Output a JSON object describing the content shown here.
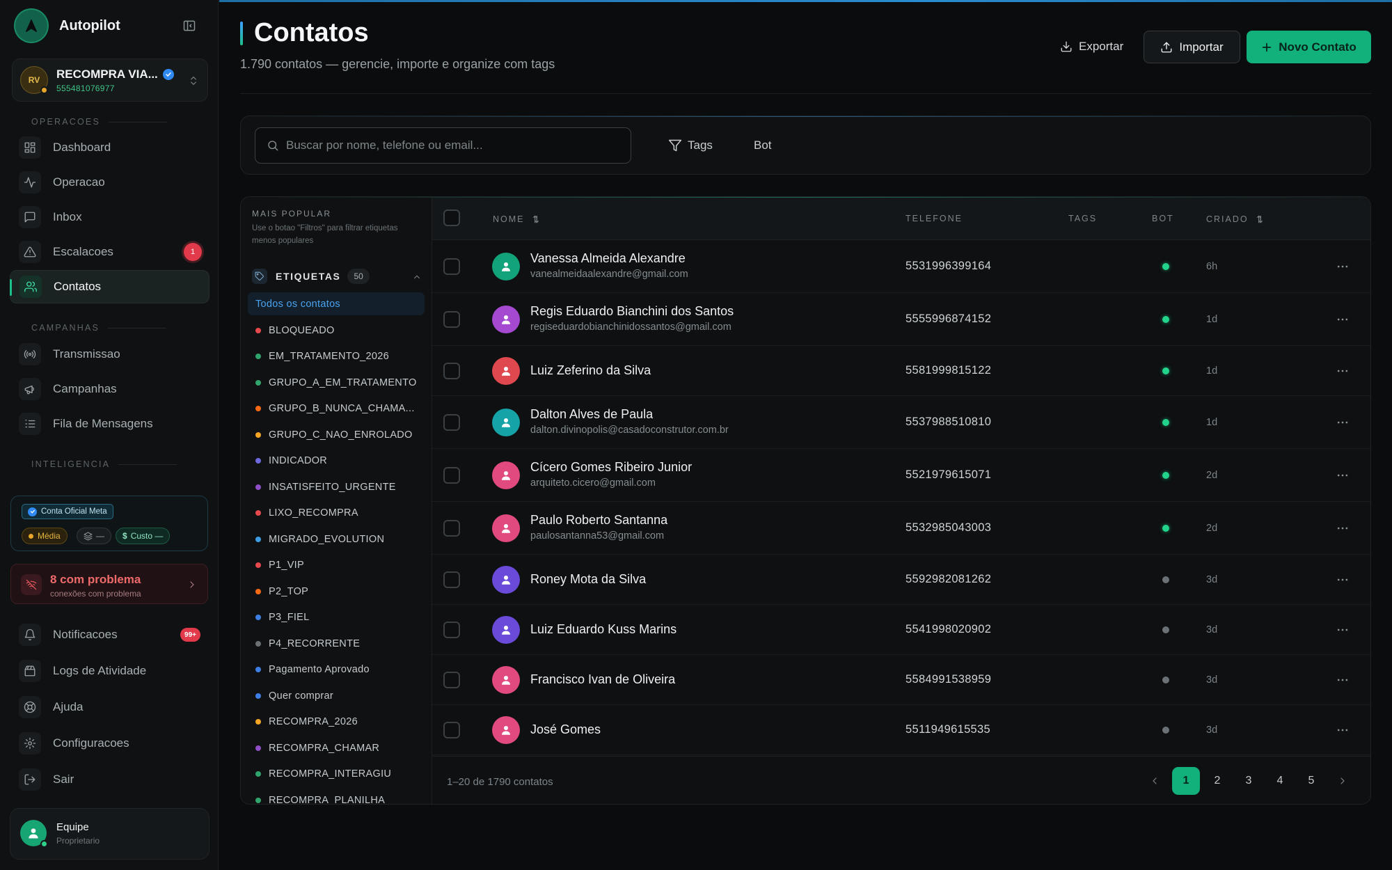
{
  "sidebar": {
    "brand": "Autopilot",
    "account": {
      "initials": "RV",
      "name": "RECOMPRA VIA...",
      "phone": "555481076977"
    },
    "sections": {
      "operacoes": "OPERACOES",
      "campanhas": "CAMPANHAS",
      "inteligencia": "INTELIGENCIA"
    },
    "nav": {
      "dashboard": "Dashboard",
      "operacao": "Operacao",
      "inbox": "Inbox",
      "escalacoes": "Escalacoes",
      "escalacoes_badge": "1",
      "contatos": "Contatos",
      "transmissao": "Transmissao",
      "campanhas": "Campanhas",
      "fila": "Fila de Mensagens",
      "notificacoes": "Notificacoes",
      "notificacoes_badge": "99+",
      "logs": "Logs de Atividade",
      "ajuda": "Ajuda",
      "configuracoes": "Configuracoes",
      "sair": "Sair"
    },
    "meta": {
      "tag": "Conta Oficial Meta",
      "quality": "Média",
      "count": "—",
      "cost": "Custo —"
    },
    "problem": {
      "title": "8 com problema",
      "subtitle": "conexões com problema"
    },
    "team": {
      "name": "Equipe",
      "role": "Proprietario"
    }
  },
  "header": {
    "title": "Contatos",
    "subtitle": "1.790 contatos — gerencie, importe e organize com tags",
    "export_label": "Exportar",
    "import_label": "Importar",
    "new_label": "Novo Contato"
  },
  "filters": {
    "search_placeholder": "Buscar por nome, telefone ou email...",
    "tags_label": "Tags",
    "bot_label": "Bot"
  },
  "tags_panel": {
    "popular_title": "MAIS POPULAR",
    "popular_desc": "Use o botao \"Filtros\" para filtrar etiquetas menos populares",
    "section_label": "ETIQUETAS",
    "count": "50",
    "all_label": "Todos os contatos",
    "items": [
      {
        "label": "BLOQUEADO",
        "color": "#e5484d"
      },
      {
        "label": "EM_TRATAMENTO_2026",
        "color": "#30a46c"
      },
      {
        "label": "GRUPO_A_EM_TRATAMENTO",
        "color": "#30a46c"
      },
      {
        "label": "GRUPO_B_NUNCA_CHAMA...",
        "color": "#f76b15"
      },
      {
        "label": "GRUPO_C_NAO_ENROLADO",
        "color": "#f5a524"
      },
      {
        "label": "INDICADOR",
        "color": "#6e6ade"
      },
      {
        "label": "INSATISFEITO_URGENTE",
        "color": "#8e4ec6"
      },
      {
        "label": "LIXO_RECOMPRA",
        "color": "#e5484d"
      },
      {
        "label": "MIGRADO_EVOLUTION",
        "color": "#3e9ee5"
      },
      {
        "label": "P1_VIP",
        "color": "#e5484d"
      },
      {
        "label": "P2_TOP",
        "color": "#f76b15"
      },
      {
        "label": "P3_FIEL",
        "color": "#3e7fe5"
      },
      {
        "label": "P4_RECORRENTE",
        "color": "#6b7175"
      },
      {
        "label": "Pagamento Aprovado",
        "color": "#3e7fe5"
      },
      {
        "label": "Quer comprar",
        "color": "#3e7fe5"
      },
      {
        "label": "RECOMPRA_2026",
        "color": "#f5a524"
      },
      {
        "label": "RECOMPRA_CHAMAR",
        "color": "#8e4ec6"
      },
      {
        "label": "RECOMPRA_INTERAGIU",
        "color": "#30a46c"
      },
      {
        "label": "RECOMPRA_PLANILHA",
        "color": "#30a46c"
      }
    ]
  },
  "table": {
    "columns": {
      "name": "NOME",
      "phone": "TELEFONE",
      "tags": "TAGS",
      "bot": "BOT",
      "created": "CRIADO"
    },
    "rows": [
      {
        "name": "Vanessa Almeida Alexandre",
        "email": "vanealmeidaalexandre@gmail.com",
        "phone": "5531996399164",
        "bot": true,
        "created": "6h",
        "avatar_color": "#12a37a"
      },
      {
        "name": "Regis Eduardo Bianchini dos Santos",
        "email": "regiseduardobianchinidossantos@gmail.com",
        "phone": "5555996874152",
        "bot": true,
        "created": "1d",
        "avatar_color": "#a54ad0"
      },
      {
        "name": "Luiz Zeferino da Silva",
        "email": "",
        "phone": "5581999815122",
        "bot": true,
        "created": "1d",
        "avatar_color": "#e0484f"
      },
      {
        "name": "Dalton Alves de Paula",
        "email": "dalton.divinopolis@casadoconstrutor.com.br",
        "phone": "5537988510810",
        "bot": true,
        "created": "1d",
        "avatar_color": "#16a3a8"
      },
      {
        "name": "Cícero Gomes Ribeiro Junior",
        "email": "arquiteto.cicero@gmail.com",
        "phone": "5521979615071",
        "bot": true,
        "created": "2d",
        "avatar_color": "#e04a7e"
      },
      {
        "name": "Paulo Roberto Santanna",
        "email": "paulosantanna53@gmail.com",
        "phone": "5532985043003",
        "bot": true,
        "created": "2d",
        "avatar_color": "#e04a7e"
      },
      {
        "name": "Roney Mota da Silva",
        "email": "",
        "phone": "5592982081262",
        "bot": false,
        "created": "3d",
        "avatar_color": "#6a4ad8"
      },
      {
        "name": "Luiz Eduardo Kuss Marins",
        "email": "",
        "phone": "5541998020902",
        "bot": false,
        "created": "3d",
        "avatar_color": "#6a4ad8"
      },
      {
        "name": "Francisco Ivan de Oliveira",
        "email": "",
        "phone": "5584991538959",
        "bot": false,
        "created": "3d",
        "avatar_color": "#e04a7e"
      },
      {
        "name": "José Gomes",
        "email": "",
        "phone": "5511949615535",
        "bot": false,
        "created": "3d",
        "avatar_color": "#e04a7e"
      }
    ],
    "footer_count": "1–20 de 1790 contatos",
    "pages": [
      "1",
      "2",
      "3",
      "4",
      "5"
    ]
  },
  "colors": {
    "accent": "#12b07a",
    "danger": "#e23a4a",
    "bot_on": "#22d38b",
    "bot_off": "#6b7175"
  }
}
